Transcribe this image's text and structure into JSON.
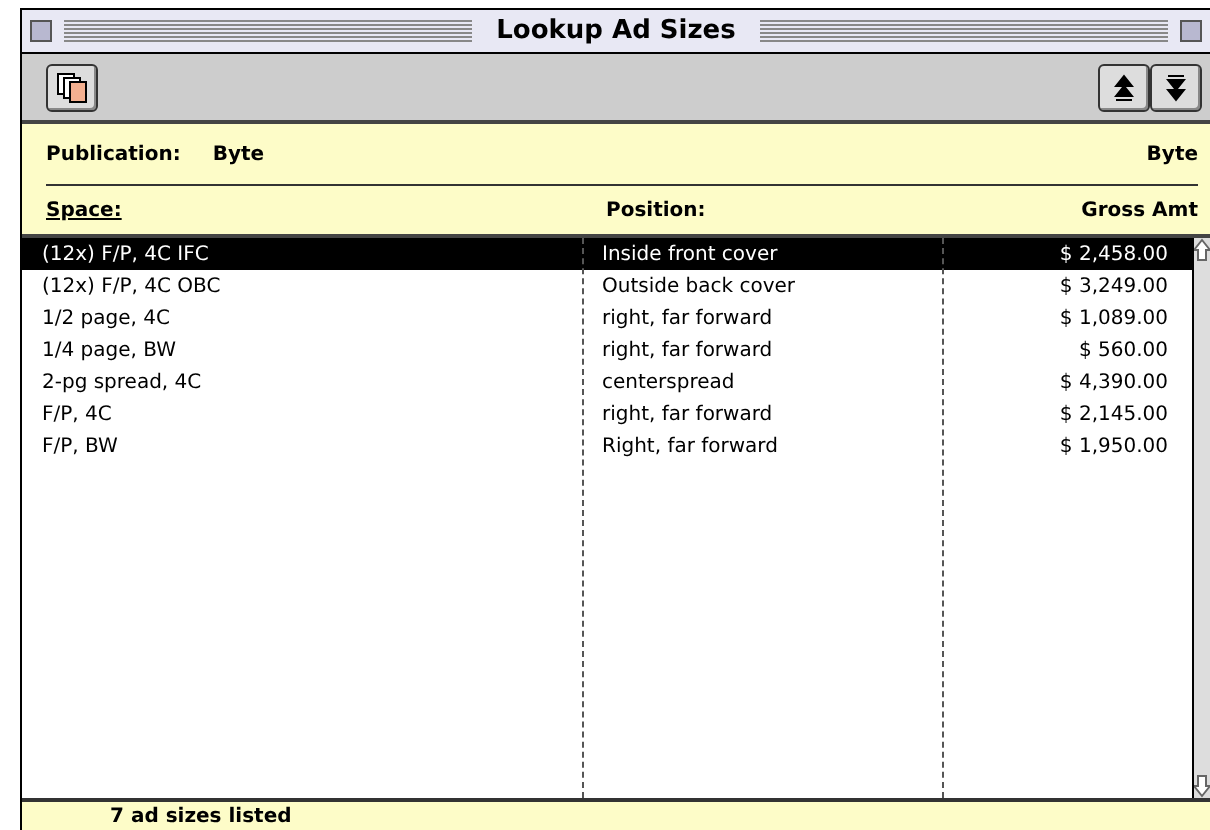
{
  "window": {
    "title": "Lookup Ad Sizes"
  },
  "header": {
    "publication_label": "Publication:",
    "publication": "Byte",
    "publication_right": "Byte"
  },
  "table": {
    "columns": [
      "Space:",
      "Position:",
      "Gross Amt"
    ],
    "rows": [
      {
        "space": "(12x) F/P, 4C IFC",
        "position": "Inside front cover",
        "amount": "$ 2,458.00",
        "selected": true
      },
      {
        "space": "(12x) F/P, 4C OBC",
        "position": "Outside back cover",
        "amount": "$ 3,249.00",
        "selected": false
      },
      {
        "space": "1/2 page, 4C",
        "position": "right, far forward",
        "amount": "$ 1,089.00",
        "selected": false
      },
      {
        "space": "1/4 page, BW",
        "position": "right, far forward",
        "amount": "$ 560.00",
        "selected": false
      },
      {
        "space": "2-pg spread, 4C",
        "position": "centerspread",
        "amount": "$ 4,390.00",
        "selected": false
      },
      {
        "space": "F/P, 4C",
        "position": "right, far forward",
        "amount": "$ 2,145.00",
        "selected": false
      },
      {
        "space": "F/P, BW",
        "position": "Right, far forward",
        "amount": "$ 1,950.00",
        "selected": false
      }
    ]
  },
  "status_bar": "7 ad sizes listed"
}
